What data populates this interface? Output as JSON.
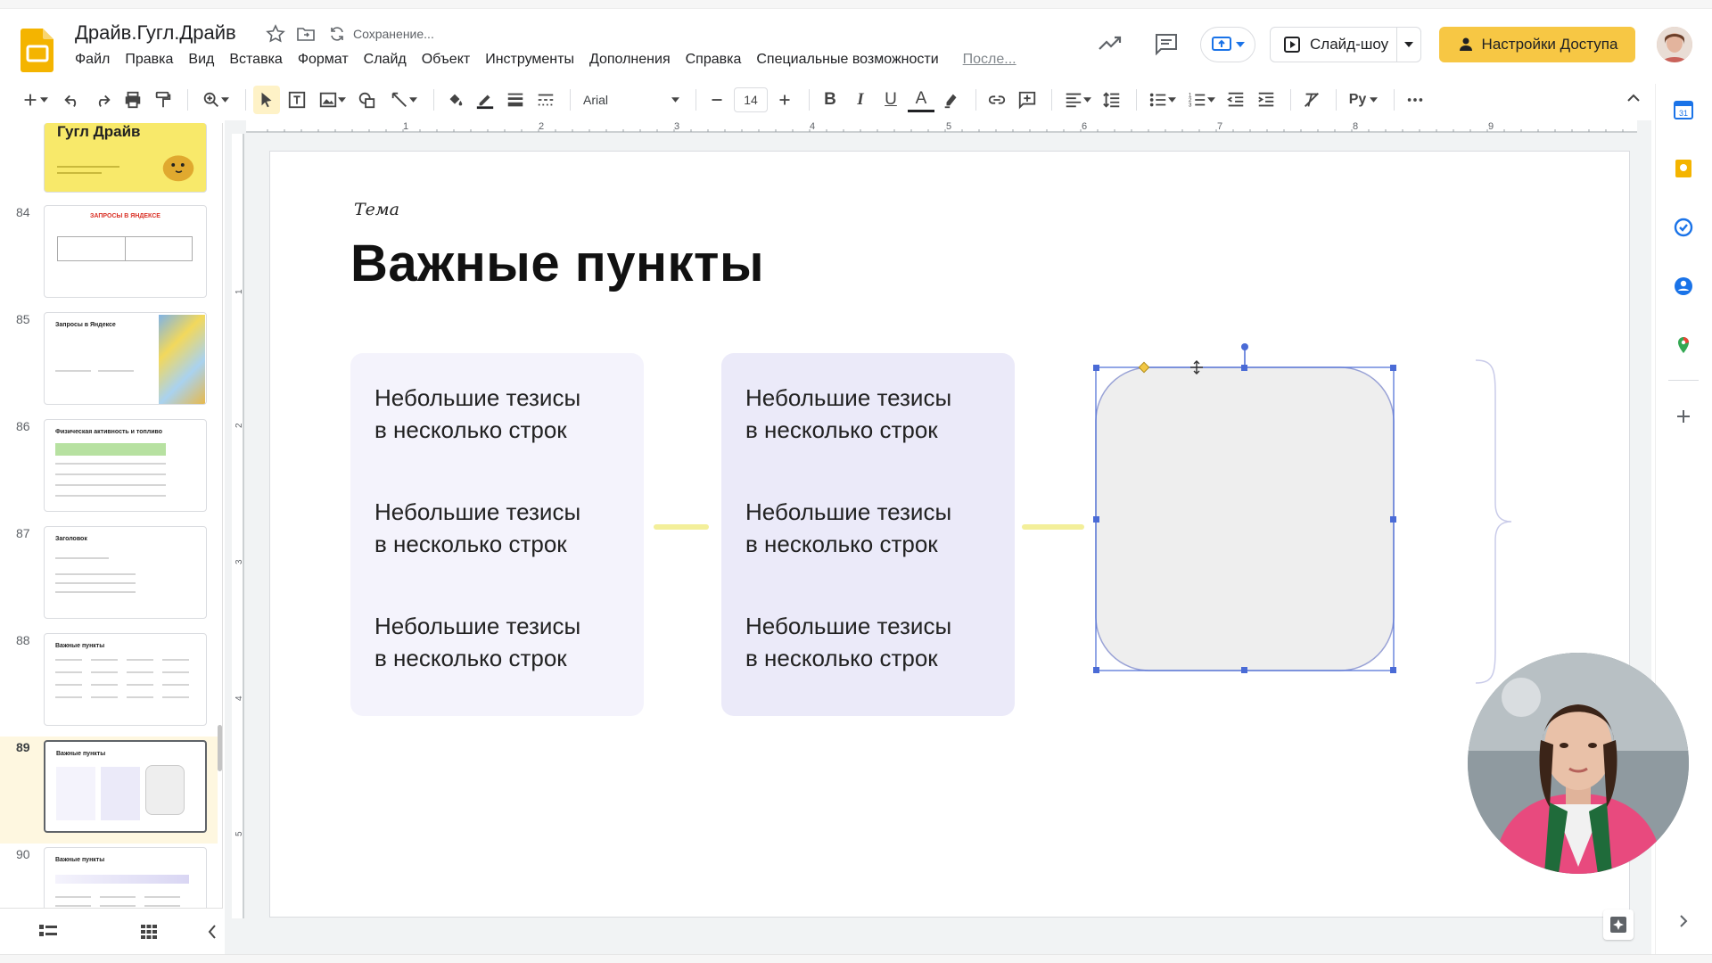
{
  "header": {
    "doc_title": "Драйв.Гугл.Драйв",
    "save_status": "Сохранение...",
    "menu": [
      "Файл",
      "Правка",
      "Вид",
      "Вставка",
      "Формат",
      "Слайд",
      "Объект",
      "Инструменты",
      "Дополнения",
      "Справка",
      "Специальные возможности"
    ],
    "last_edit": "После...",
    "slideshow_label": "Слайд-шоу",
    "share_label": "Настройки Доступа"
  },
  "toolbar": {
    "font_name": "Arial",
    "font_size": "14",
    "bold": "B",
    "italic": "I",
    "underline": "U",
    "text_color": "A",
    "input_tools": "Ру"
  },
  "sidebar": {
    "slide_numbers": [
      "84",
      "85",
      "86",
      "87",
      "88",
      "89",
      "90"
    ],
    "prev_title_line1": "Гугл Драйв",
    "thumb_84_title": "ЗАПРОСЫ В ЯНДЕКСЕ",
    "thumb_85_title": "Запросы в Яндексе",
    "thumb_86_title": "Физическая активность и топливо",
    "thumb_87_title": "Заголовок",
    "thumb_88_title": "Важные пункты",
    "thumb_89_title": "Важные пункты",
    "thumb_90_title": "Важные пункты",
    "active_slide": "89"
  },
  "slide": {
    "topic": "Тема",
    "title": "Важные пункты",
    "col1": [
      "Небольшие тезисы\nв несколько строк",
      "Небольшие тезисы\nв несколько строк",
      "Небольшие тезисы\nв несколько строк"
    ],
    "col2": [
      "Небольшие тезисы\nв несколько строк",
      "Небольшие тезисы\nв несколько строк",
      "Небольшие тезисы\nв несколько строк"
    ]
  },
  "colors": {
    "accent_yellow": "#f7c744",
    "card1_bg": "#f4f3fc",
    "card2_bg": "#ebeaf9",
    "selected_shape_fill": "#eeeeee",
    "selection_handles": "#4a6bd6",
    "arrow": "#f3ef9a"
  }
}
